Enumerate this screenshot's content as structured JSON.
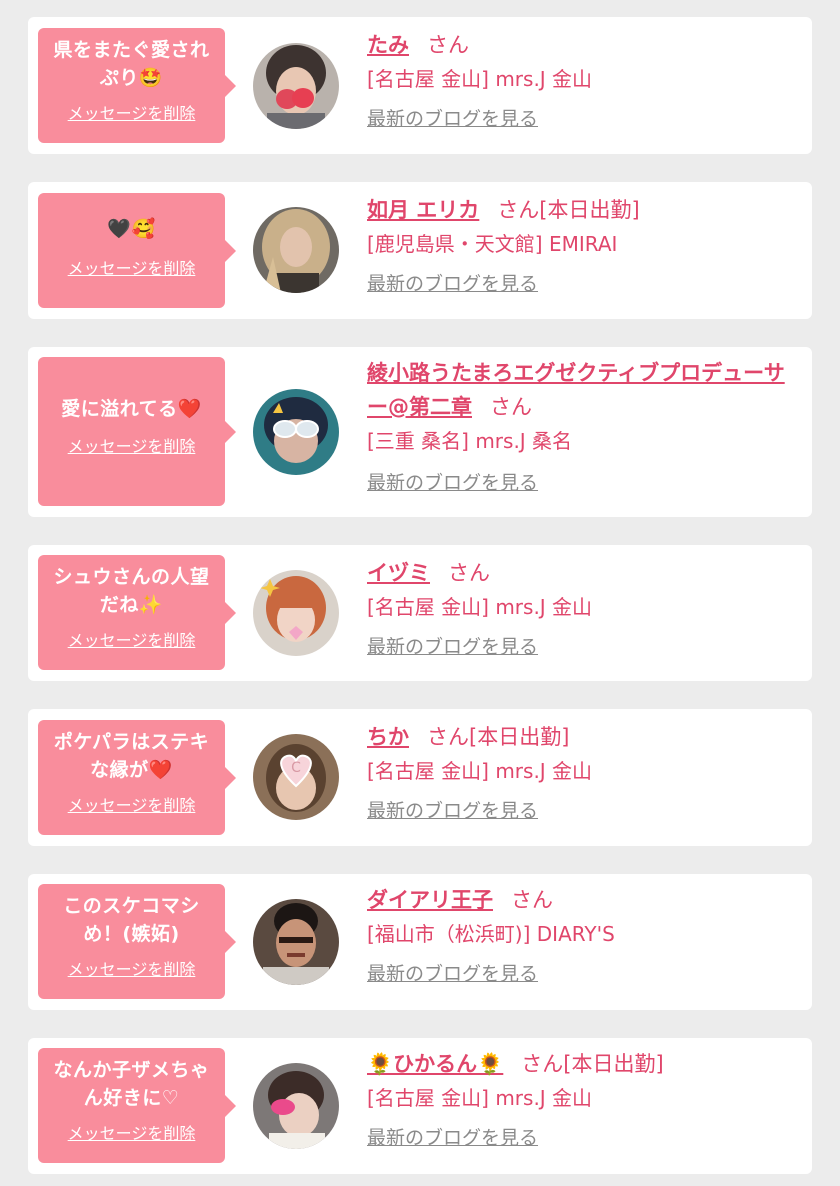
{
  "cards": [
    {
      "message": "県をまたぐ愛され\nぷり🤩",
      "delete_label": "メッセージを削除",
      "name": "たみ",
      "suffix": "さん",
      "shop": "[名古屋 金山] mrs.J 金山",
      "blog_label": "最新のブログを見る"
    },
    {
      "message": "🖤🥰",
      "delete_label": "メッセージを削除",
      "name": "如月 エリカ",
      "suffix": "さん[本日出勤]",
      "shop": "[鹿児島県・天文館] EMIRAI",
      "blog_label": "最新のブログを見る"
    },
    {
      "message": "愛に溢れてる❤️",
      "delete_label": "メッセージを削除",
      "name": "綾小路うたまろエグゼクティブプロデューサー@第二章",
      "suffix": "さん",
      "shop": "[三重 桑名] mrs.J 桑名",
      "blog_label": "最新のブログを見る"
    },
    {
      "message": "シュウさんの人望\nだね✨",
      "delete_label": "メッセージを削除",
      "name": "イヅミ",
      "suffix": "さん",
      "shop": "[名古屋 金山] mrs.J 金山",
      "blog_label": "最新のブログを見る"
    },
    {
      "message": "ポケパラはステキ\nな縁が❤️",
      "delete_label": "メッセージを削除",
      "name": "ちか",
      "suffix": "さん[本日出勤]",
      "shop": "[名古屋 金山] mrs.J 金山",
      "blog_label": "最新のブログを見る"
    },
    {
      "message": "このスケコマシ\nめ！(嫉妬)",
      "delete_label": "メッセージを削除",
      "name": "ダイアリ王子",
      "suffix": "さん",
      "shop": "[福山市（松浜町)] DIARY'S",
      "blog_label": "最新のブログを見る"
    },
    {
      "message": "なんか子ザメちゃ\nん好きに♡",
      "delete_label": "メッセージを削除",
      "name": "🌻ひかるん🌻",
      "suffix": "さん[本日出勤]",
      "shop": "[名古屋 金山] mrs.J 金山",
      "blog_label": "最新のブログを見る"
    }
  ],
  "colors": {
    "background": "#ececec",
    "card": "#ffffff",
    "bubble": "#f98d9c",
    "accent": "#e0466b",
    "link_gray": "#8a8a8a"
  }
}
